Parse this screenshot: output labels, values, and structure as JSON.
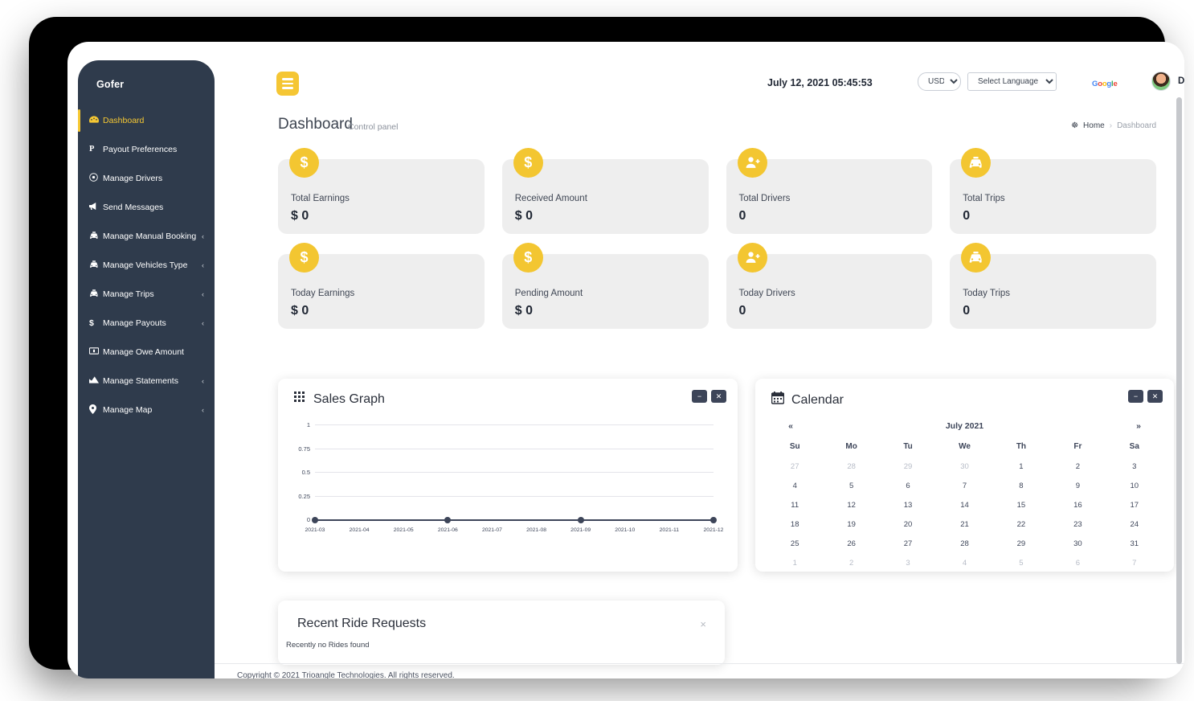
{
  "sidebar": {
    "brand": "Gofer",
    "items": [
      {
        "label": "Dashboard",
        "icon": "dashboard-icon",
        "glyph": "☸",
        "active": true,
        "caret": false
      },
      {
        "label": "Payout Preferences",
        "icon": "paypal-icon",
        "glyph": "℗",
        "active": false,
        "caret": false
      },
      {
        "label": "Manage Drivers",
        "icon": "driver-icon",
        "glyph": "Ⓧ",
        "active": false,
        "caret": false
      },
      {
        "label": "Send Messages",
        "icon": "megaphone-icon",
        "glyph": "◤",
        "active": false,
        "caret": false
      },
      {
        "label": "Manage Manual Booking",
        "icon": "taxi-icon",
        "glyph": "Ὡ5",
        "active": false,
        "caret": true
      },
      {
        "label": "Manage Vehicles Type",
        "icon": "taxi-icon",
        "glyph": "Ὡ5",
        "active": false,
        "caret": true
      },
      {
        "label": "Manage Trips",
        "icon": "taxi-icon",
        "glyph": "Ὡ5",
        "active": false,
        "caret": true
      },
      {
        "label": "Manage Payouts",
        "icon": "dollar-icon",
        "glyph": "$",
        "active": false,
        "caret": true
      },
      {
        "label": "Manage Owe Amount",
        "icon": "money-bill-icon",
        "glyph": "▤",
        "active": false,
        "caret": false
      },
      {
        "label": "Manage Statements",
        "icon": "chart-bar-icon",
        "glyph": "ὌA",
        "active": false,
        "caret": true
      },
      {
        "label": "Manage Map",
        "icon": "map-marker-icon",
        "glyph": "⚑",
        "active": false,
        "caret": true
      }
    ],
    "caret_glyph": "‹"
  },
  "topbar": {
    "menu_toggle": "menu-toggle",
    "datetime": "July 12, 2021 05:45:53",
    "currency": {
      "selected": "USD",
      "options": [
        "USD"
      ]
    },
    "language": {
      "selected": "Select Language",
      "options": [
        "Select Language"
      ]
    },
    "google_badge": "Google",
    "user": {
      "name": "Devin",
      "avatar": "user-avatar"
    }
  },
  "page": {
    "title": "Dashboard",
    "subtitle": "Control panel",
    "breadcrumb": {
      "home": "Home",
      "separator": "›",
      "current": "Dashboard"
    }
  },
  "stats": [
    {
      "label": "Total Earnings",
      "value": "$ 0",
      "icon": "dollar-icon"
    },
    {
      "label": "Received Amount",
      "value": "$ 0",
      "icon": "dollar-icon"
    },
    {
      "label": "Total Drivers",
      "value": "0",
      "icon": "user-plus-icon"
    },
    {
      "label": "Total Trips",
      "value": "0",
      "icon": "taxi-icon"
    },
    {
      "label": "Today Earnings",
      "value": "$ 0",
      "icon": "dollar-icon"
    },
    {
      "label": "Pending Amount",
      "value": "$ 0",
      "icon": "dollar-icon"
    },
    {
      "label": "Today Drivers",
      "value": "0",
      "icon": "user-plus-icon"
    },
    {
      "label": "Today Trips",
      "value": "0",
      "icon": "taxi-icon"
    }
  ],
  "sales_panel": {
    "title": "Sales Graph",
    "icon": "grid-icon",
    "minimize_label": "−",
    "close_label": "✕"
  },
  "chart_data": {
    "type": "line",
    "title": "Sales Graph",
    "x": [
      "2021-03",
      "2021-04",
      "2021-05",
      "2021-06",
      "2021-07",
      "2021-08",
      "2021-09",
      "2021-10",
      "2021-11",
      "2021-12"
    ],
    "values": [
      0,
      0,
      0,
      0,
      0,
      0,
      0,
      0,
      0,
      0
    ],
    "yticks": [
      "1",
      "0.75",
      "0.5",
      "0.25",
      "0"
    ],
    "ylim": [
      0,
      1
    ],
    "xlabel": "",
    "ylabel": "",
    "grid": true,
    "legend": "none",
    "marker_points": [
      "2021-03",
      "2021-06",
      "2021-09",
      "2021-12"
    ]
  },
  "calendar_panel": {
    "title": "Calendar",
    "icon": "calendar-icon",
    "minimize_label": "−",
    "close_label": "✕",
    "prev_label": "«",
    "next_label": "»",
    "month": "July 2021",
    "weekdays": [
      "Su",
      "Mo",
      "Tu",
      "We",
      "Th",
      "Fr",
      "Sa"
    ],
    "weeks": [
      [
        {
          "d": "27",
          "muted": true
        },
        {
          "d": "28",
          "muted": true
        },
        {
          "d": "29",
          "muted": true
        },
        {
          "d": "30",
          "muted": true
        },
        {
          "d": "1",
          "muted": false
        },
        {
          "d": "2",
          "muted": false
        },
        {
          "d": "3",
          "muted": false
        }
      ],
      [
        {
          "d": "4",
          "muted": false
        },
        {
          "d": "5",
          "muted": false
        },
        {
          "d": "6",
          "muted": false
        },
        {
          "d": "7",
          "muted": false
        },
        {
          "d": "8",
          "muted": false
        },
        {
          "d": "9",
          "muted": false
        },
        {
          "d": "10",
          "muted": false
        }
      ],
      [
        {
          "d": "11",
          "muted": false
        },
        {
          "d": "12",
          "muted": false
        },
        {
          "d": "13",
          "muted": false
        },
        {
          "d": "14",
          "muted": false
        },
        {
          "d": "15",
          "muted": false
        },
        {
          "d": "16",
          "muted": false
        },
        {
          "d": "17",
          "muted": false
        }
      ],
      [
        {
          "d": "18",
          "muted": false
        },
        {
          "d": "19",
          "muted": false
        },
        {
          "d": "20",
          "muted": false
        },
        {
          "d": "21",
          "muted": false
        },
        {
          "d": "22",
          "muted": false
        },
        {
          "d": "23",
          "muted": false
        },
        {
          "d": "24",
          "muted": false
        }
      ],
      [
        {
          "d": "25",
          "muted": false
        },
        {
          "d": "26",
          "muted": false
        },
        {
          "d": "27",
          "muted": false
        },
        {
          "d": "28",
          "muted": false
        },
        {
          "d": "29",
          "muted": false
        },
        {
          "d": "30",
          "muted": false
        },
        {
          "d": "31",
          "muted": false
        }
      ],
      [
        {
          "d": "1",
          "muted": true
        },
        {
          "d": "2",
          "muted": true
        },
        {
          "d": "3",
          "muted": true
        },
        {
          "d": "4",
          "muted": true
        },
        {
          "d": "5",
          "muted": true
        },
        {
          "d": "6",
          "muted": true
        },
        {
          "d": "7",
          "muted": true
        }
      ]
    ]
  },
  "rides_panel": {
    "title": "Recent Ride Requests",
    "empty_text": "Recently no Rides found",
    "close_label": "×"
  },
  "footer": {
    "text": "Copyright © 2021 Trioangle Technologies. All rights reserved."
  },
  "colors": {
    "accent": "#f3c631",
    "sidebar": "#2f3b4c",
    "panel_button": "#3d4559",
    "card_bg": "#eeeeee"
  }
}
